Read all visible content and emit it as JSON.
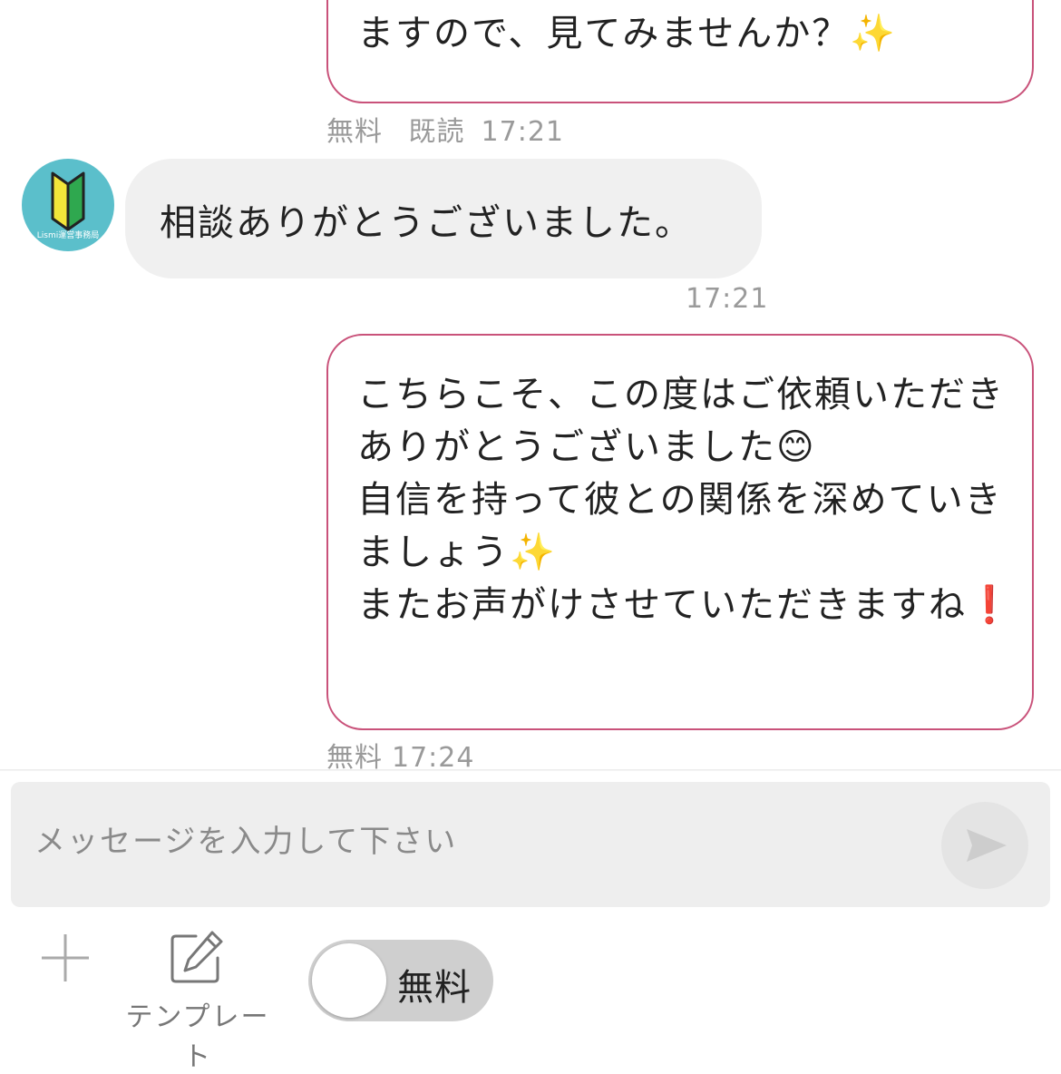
{
  "messages": [
    {
      "direction": "out",
      "text": "ますので、見てみませんか？✨",
      "meta": {
        "price": "無料",
        "read": "既読",
        "time": "17:21"
      }
    },
    {
      "direction": "in",
      "sender_avatar_label": "Lismi運営事務局",
      "text": "相談ありがとうございました。",
      "meta": {
        "time": "17:21"
      }
    },
    {
      "direction": "out",
      "text": "こちらこそ、この度はご依頼いただきありがとうございました😊\n自信を持って彼との関係を深めていきましょう✨\nまたお声がけさせていただきますね❗",
      "meta": {
        "price": "無料",
        "time": "17:24"
      }
    }
  ],
  "composer": {
    "placeholder": "メッセージを入力して下さい",
    "template_label": "テンプレート",
    "toggle_label": "無料",
    "toggle_on": false
  },
  "colors": {
    "outgoing_border": "#c9527a",
    "incoming_bg": "#f0f0f0",
    "avatar_bg": "#5bbfcb",
    "meta_text": "#9a9a9a"
  },
  "icons": [
    "beginner-mark-icon",
    "send-icon",
    "plus-icon",
    "edit-icon"
  ]
}
